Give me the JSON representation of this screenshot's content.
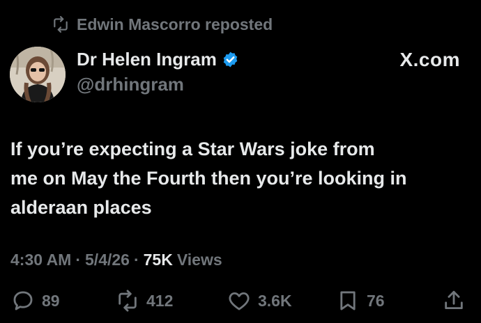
{
  "repost": {
    "icon": "repost-icon",
    "text": "Edwin Mascorro reposted"
  },
  "author": {
    "display_name": "Dr Helen Ingram",
    "handle": "@drhingram",
    "verified": true,
    "verified_color": "#1d9bf0",
    "avatar_icon": "avatar-photo"
  },
  "brand": "X.com",
  "tweet": {
    "text": "If you’re expecting a Star Wars joke from\nme on May the Fourth then you’re looking in\nalderaan places"
  },
  "meta": {
    "time": "4:30 AM",
    "sep1": "·",
    "date": "5/4/26",
    "sep2": "·",
    "views_count": "75K",
    "views_label": "Views"
  },
  "actions": {
    "reply": {
      "icon": "reply-icon",
      "count": "89"
    },
    "repost": {
      "icon": "repost-icon",
      "count": "412"
    },
    "like": {
      "icon": "heart-icon",
      "count": "3.6K"
    },
    "bookmark": {
      "icon": "bookmark-icon",
      "count": "76"
    },
    "share": {
      "icon": "share-icon"
    }
  },
  "colors": {
    "background": "#000000",
    "text": "#e7e9ea",
    "muted": "#71767b"
  }
}
